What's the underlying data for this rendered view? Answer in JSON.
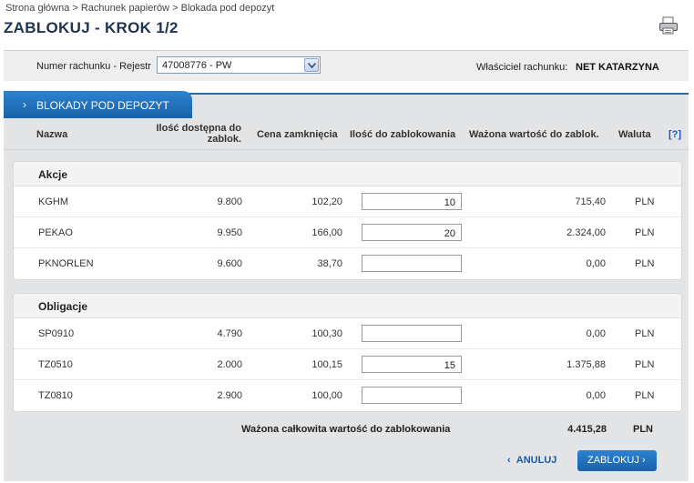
{
  "breadcrumb": "Strona główna > Rachunek papierów > Blokada pod depozyt",
  "title": "ZABLOKUJ - KROK 1/2",
  "account": {
    "label": "Numer rachunku - Rejestr",
    "selected": "47008776 - PW",
    "owner_label": "Właściciel rachunku:",
    "owner_name": "NET KATARZYNA"
  },
  "tab": {
    "label": "BLOKADY POD DEPOZYT"
  },
  "columns": {
    "name": "Nazwa",
    "available_line1": "Ilość dostępna do",
    "available_line2": "zablok.",
    "close_price": "Cena zamknięcia",
    "qty_to_block": "Ilość do zablokowania",
    "weighted_value": "Ważona wartość do zablok.",
    "currency": "Waluta",
    "help": "[?]"
  },
  "sections": [
    {
      "title": "Akcje",
      "rows": [
        {
          "name": "KGHM",
          "available": "9.800",
          "price": "102,20",
          "qty": "10",
          "value": "715,40",
          "currency": "PLN"
        },
        {
          "name": "PEKAO",
          "available": "9.950",
          "price": "166,00",
          "qty": "20",
          "value": "2.324,00",
          "currency": "PLN"
        },
        {
          "name": "PKNORLEN",
          "available": "9.600",
          "price": "38,70",
          "qty": "",
          "value": "0,00",
          "currency": "PLN"
        }
      ]
    },
    {
      "title": "Obligacje",
      "rows": [
        {
          "name": "SP0910",
          "available": "4.790",
          "price": "100,30",
          "qty": "",
          "value": "0,00",
          "currency": "PLN"
        },
        {
          "name": "TZ0510",
          "available": "2.000",
          "price": "100,15",
          "qty": "15",
          "value": "1.375,88",
          "currency": "PLN"
        },
        {
          "name": "TZ0810",
          "available": "2.900",
          "price": "100,00",
          "qty": "",
          "value": "0,00",
          "currency": "PLN"
        }
      ]
    }
  ],
  "total": {
    "label": "Ważona całkowita wartość do zablokowania",
    "value": "4.415,28",
    "currency": "PLN"
  },
  "actions": {
    "cancel": "ANULUJ",
    "block": "ZABLOKUJ"
  },
  "colors": {
    "accent": "#1b6db8",
    "link": "#1b5aa8",
    "panel_bg": "#e3e4e6"
  }
}
